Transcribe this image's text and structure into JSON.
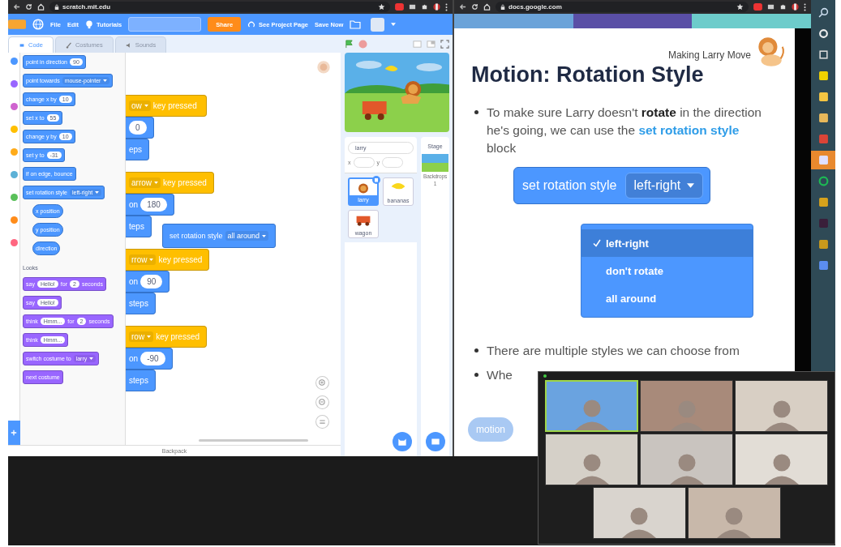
{
  "left_browser": {
    "url": "scratch.mit.edu"
  },
  "scratch": {
    "menu": {
      "file": "File",
      "edit": "Edit",
      "tutorials": "Tutorials",
      "share": "Share",
      "project_page": "See Project Page",
      "save": "Save Now"
    },
    "tabs": [
      {
        "label": "Code",
        "selected": true
      },
      {
        "label": "Costumes",
        "selected": false
      },
      {
        "label": "Sounds",
        "selected": false
      }
    ],
    "categories": [
      {
        "color": "#4c97ff"
      },
      {
        "color": "#9966ff"
      },
      {
        "color": "#cf63cf"
      },
      {
        "color": "#ffbf00"
      },
      {
        "color": "#ffab19"
      },
      {
        "color": "#5cb1d6"
      },
      {
        "color": "#59c059"
      },
      {
        "color": "#ff8c1a"
      },
      {
        "color": "#ff6680"
      }
    ],
    "palette": [
      {
        "kind": "motion",
        "parts": [
          {
            "kind": "label",
            "text": "point in direction"
          },
          {
            "kind": "input",
            "text": "90"
          }
        ]
      },
      {
        "kind": "motion",
        "parts": [
          {
            "kind": "label",
            "text": "point towards"
          },
          {
            "kind": "dropdown",
            "text": "mouse-pointer"
          }
        ]
      },
      {
        "kind": "motion",
        "parts": [
          {
            "kind": "label",
            "text": "change x by"
          },
          {
            "kind": "input",
            "text": "10"
          }
        ]
      },
      {
        "kind": "motion",
        "parts": [
          {
            "kind": "label",
            "text": "set x to"
          },
          {
            "kind": "input",
            "text": "55"
          }
        ]
      },
      {
        "kind": "motion",
        "parts": [
          {
            "kind": "label",
            "text": "change y by"
          },
          {
            "kind": "input",
            "text": "10"
          }
        ]
      },
      {
        "kind": "motion",
        "parts": [
          {
            "kind": "label",
            "text": "set y to"
          },
          {
            "kind": "input",
            "text": "-31"
          }
        ]
      },
      {
        "kind": "motion",
        "parts": [
          {
            "kind": "label",
            "text": "if on edge, bounce"
          }
        ]
      },
      {
        "kind": "motion",
        "parts": [
          {
            "kind": "label",
            "text": "set rotation style"
          },
          {
            "kind": "dropdown",
            "text": "left-right"
          }
        ]
      },
      {
        "kind": "reporter",
        "parts": [
          {
            "kind": "label",
            "text": "x position"
          }
        ]
      },
      {
        "kind": "reporter",
        "parts": [
          {
            "kind": "label",
            "text": "y position"
          }
        ]
      },
      {
        "kind": "reporter",
        "parts": [
          {
            "kind": "label",
            "text": "direction"
          }
        ]
      },
      {
        "kind": "heading",
        "text": "Looks"
      },
      {
        "kind": "looks",
        "parts": [
          {
            "kind": "label",
            "text": "say"
          },
          {
            "kind": "input",
            "text": "Hello!"
          },
          {
            "kind": "label",
            "text": "for"
          },
          {
            "kind": "input",
            "text": "2"
          },
          {
            "kind": "label",
            "text": "seconds"
          }
        ]
      },
      {
        "kind": "looks",
        "parts": [
          {
            "kind": "label",
            "text": "say"
          },
          {
            "kind": "input",
            "text": "Hello!"
          }
        ]
      },
      {
        "kind": "looks",
        "parts": [
          {
            "kind": "label",
            "text": "think"
          },
          {
            "kind": "input",
            "text": "Hmm..."
          },
          {
            "kind": "label",
            "text": "for"
          },
          {
            "kind": "input",
            "text": "2"
          },
          {
            "kind": "label",
            "text": "seconds"
          }
        ]
      },
      {
        "kind": "looks",
        "parts": [
          {
            "kind": "label",
            "text": "think"
          },
          {
            "kind": "input",
            "text": "Hmm..."
          }
        ]
      },
      {
        "kind": "looks",
        "parts": [
          {
            "kind": "label",
            "text": "switch costume to"
          },
          {
            "kind": "dropdown",
            "text": "larry"
          }
        ]
      },
      {
        "kind": "looks",
        "parts": [
          {
            "kind": "label",
            "text": "next costume"
          }
        ]
      }
    ],
    "scripts": [
      {
        "blocks": [
          {
            "kind": "event",
            "parts": [
              {
                "kind": "dropdown",
                "text": "ow"
              },
              {
                "kind": "label",
                "text": "key pressed"
              }
            ]
          },
          {
            "kind": "motion",
            "parts": [
              {
                "kind": "input",
                "text": "0"
              }
            ]
          },
          {
            "kind": "motion",
            "parts": [
              {
                "kind": "label",
                "text": "eps"
              }
            ]
          }
        ]
      },
      {
        "blocks": [
          {
            "kind": "event",
            "parts": [
              {
                "kind": "dropdown",
                "text": "arrow"
              },
              {
                "kind": "label",
                "text": "key pressed"
              }
            ]
          },
          {
            "kind": "motion",
            "parts": [
              {
                "kind": "label",
                "text": "on"
              },
              {
                "kind": "input",
                "text": "180"
              }
            ]
          },
          {
            "kind": "motion",
            "parts": [
              {
                "kind": "label",
                "text": "teps"
              }
            ]
          }
        ]
      },
      {
        "blocks": [
          {
            "kind": "event",
            "parts": [
              {
                "kind": "dropdown",
                "text": "rrow"
              },
              {
                "kind": "label",
                "text": "key pressed"
              }
            ]
          },
          {
            "kind": "motion",
            "parts": [
              {
                "kind": "label",
                "text": "on"
              },
              {
                "kind": "input",
                "text": "90"
              }
            ]
          },
          {
            "kind": "motion",
            "parts": [
              {
                "kind": "label",
                "text": "steps"
              }
            ]
          }
        ]
      },
      {
        "blocks": [
          {
            "kind": "event",
            "parts": [
              {
                "kind": "dropdown",
                "text": "row"
              },
              {
                "kind": "label",
                "text": "key pressed"
              }
            ]
          },
          {
            "kind": "motion",
            "parts": [
              {
                "kind": "label",
                "text": "on"
              },
              {
                "kind": "input",
                "text": "-90"
              }
            ]
          },
          {
            "kind": "motion",
            "parts": [
              {
                "kind": "label",
                "text": "steps"
              }
            ]
          }
        ]
      }
    ],
    "loose_block": {
      "kind": "motion",
      "parts": [
        {
          "kind": "label",
          "text": "set rotation style"
        },
        {
          "kind": "dropdown",
          "text": "all around"
        }
      ]
    },
    "backpack": "Backpack",
    "sprite_info": {
      "name": "larry",
      "x_label": "x",
      "y_label": "y"
    },
    "sprites": [
      {
        "name": "larry",
        "selected": true
      },
      {
        "name": "bananas",
        "selected": false
      },
      {
        "name": "wagon",
        "selected": false
      }
    ],
    "stage_panel": {
      "title": "Stage",
      "backdrops_label": "Backdrops",
      "backdrops_count": "1"
    }
  },
  "right_browser": {
    "url": "docs.google.com"
  },
  "slide": {
    "header": "Making Larry Move",
    "title": "Motion: Rotation Style",
    "bullets": [
      {
        "parts": [
          {
            "kind": "plain",
            "text": "To make sure Larry doesn't "
          },
          {
            "kind": "bold",
            "text": "rotate"
          },
          {
            "kind": "plain",
            "text": " in the direction he's going, we can use the "
          },
          {
            "kind": "link",
            "text": "set rotation style"
          },
          {
            "kind": "plain",
            "text": " block"
          }
        ]
      },
      {
        "parts": [
          {
            "kind": "plain",
            "text": "There are multiple styles we can choose from"
          }
        ]
      },
      {
        "parts": [
          {
            "kind": "plain",
            "text": "Whe"
          }
        ]
      }
    ],
    "block": {
      "label": "set rotation style",
      "value": "left-right"
    },
    "menu": [
      {
        "label": "left-right",
        "selected": true
      },
      {
        "label": "don't rotate",
        "selected": false
      },
      {
        "label": "all around",
        "selected": false
      }
    ],
    "chip": "motion"
  },
  "video_call": {
    "tiles": [
      {
        "selected": true
      },
      {
        "selected": false
      },
      {
        "selected": false
      },
      {
        "selected": false
      },
      {
        "selected": false
      },
      {
        "selected": false
      },
      {
        "selected": false
      },
      {
        "selected": false
      }
    ]
  },
  "taskbar": {
    "items": [
      {
        "kind": "search",
        "selected": false
      },
      {
        "kind": "ring",
        "selected": false
      },
      {
        "kind": "taskview",
        "selected": false
      },
      {
        "kind": "app",
        "color": "#f2d200",
        "selected": false
      },
      {
        "kind": "app",
        "color": "#f5c542",
        "selected": false
      },
      {
        "kind": "app",
        "color": "#e8b85a",
        "selected": false
      },
      {
        "kind": "app",
        "color": "#db4437",
        "selected": false
      },
      {
        "kind": "app",
        "color": "#e0e0ff",
        "selected": true
      },
      {
        "kind": "ringapp",
        "color": "#1db954",
        "selected": false
      },
      {
        "kind": "app",
        "color": "#d6a21c",
        "selected": false
      },
      {
        "kind": "app",
        "color": "#3a1f3a",
        "selected": false
      },
      {
        "kind": "app",
        "color": "#c99a1c",
        "selected": false
      },
      {
        "kind": "app",
        "color": "#5b8def",
        "selected": false
      }
    ]
  }
}
